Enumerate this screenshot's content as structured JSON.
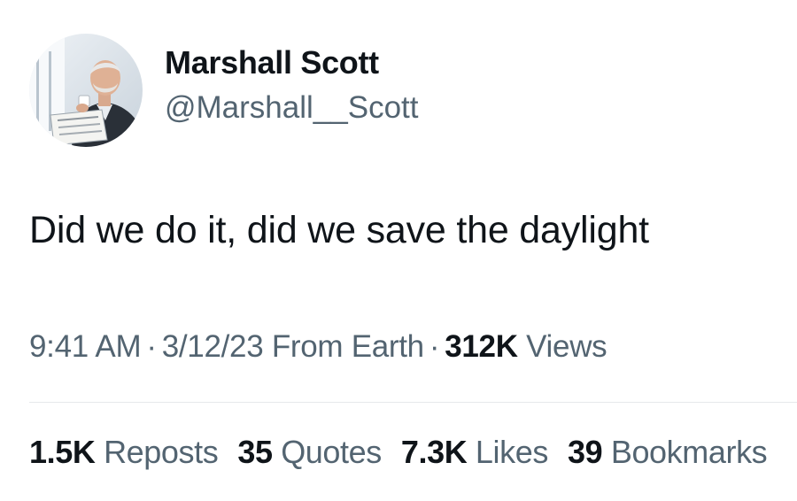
{
  "author": {
    "name": "Marshall Scott",
    "handle": "@Marshall__Scott"
  },
  "post": {
    "text": "Did we do it, did we save the daylight",
    "time": "9:41 AM",
    "date": "3/12/23",
    "source": "From Earth",
    "separator": "·",
    "views_count": "312K",
    "views_label": "Views"
  },
  "stats": [
    {
      "count": "1.5K",
      "label": "Reposts"
    },
    {
      "count": "35",
      "label": "Quotes"
    },
    {
      "count": "7.3K",
      "label": "Likes"
    },
    {
      "count": "39",
      "label": "Bookmarks"
    }
  ],
  "colors": {
    "primary_text": "#0f1419",
    "secondary_text": "#536471",
    "divider": "#e6e9eb"
  }
}
